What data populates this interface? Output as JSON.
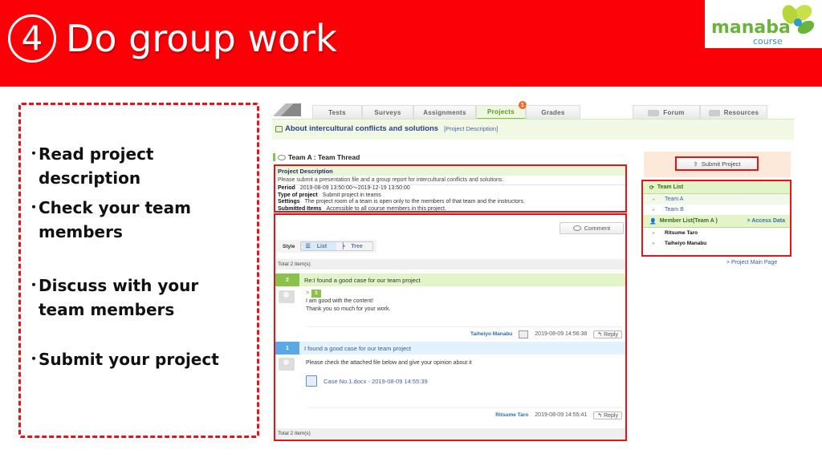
{
  "slide": {
    "step_number": "4",
    "title": "Do group work",
    "logo": {
      "brand": "manaba",
      "sub": "course"
    },
    "steps": [
      {
        "bullet": "・",
        "text": "Read project description"
      },
      {
        "bullet": "・",
        "text": "Check your team members"
      },
      {
        "bullet": "・",
        "text": "Discuss with your team members"
      },
      {
        "bullet": "・",
        "text": "Submit your project"
      }
    ]
  },
  "app": {
    "tabs": [
      {
        "label": "Tests"
      },
      {
        "label": "Surveys"
      },
      {
        "label": "Assignments"
      },
      {
        "label": "Projects",
        "badge": "1",
        "active": true
      },
      {
        "label": "Grades"
      }
    ],
    "right_tabs": [
      {
        "label": "Forum",
        "icon": "speech-bubble-icon"
      },
      {
        "label": "Resources",
        "icon": "book-icon"
      }
    ],
    "course_title": "About intercultural conflicts and solutions",
    "course_sub": "[Project Description]",
    "thread_title": "Team A : Team Thread",
    "description": {
      "heading": "Project Description",
      "text": "Please submit a presentation file and a group report for intercultural conflicts and solutions.",
      "meta": [
        {
          "label": "Period",
          "value": "2019-08-09 13:50:00～2019-12-19 13:50:00"
        },
        {
          "label": "Type of project",
          "value": "Submit project in teams"
        },
        {
          "label": "Settings",
          "value": "The project room of a team is open only to the members of that team and the instructors."
        },
        {
          "label": "Submitted Items",
          "value": "Accessible to all course members in this project."
        }
      ]
    },
    "comment_label": "Comment",
    "style_label": "Style",
    "style_options": {
      "list": "List",
      "tree": "Tree"
    },
    "total_label": "Total 2 item(s)",
    "posts": [
      {
        "number": "2",
        "title": "Re:I found a good case for our team project",
        "reply_to": "1",
        "lines": [
          "I am good with the content!",
          "Thank you so much for your work."
        ],
        "author": "Taiheiyo Manabu",
        "timestamp": "2019-08-09 14:56:38",
        "reply_label": "Reply"
      },
      {
        "number": "1",
        "title": "I found a good case for our team project",
        "lines": [
          "Please check the attached file below and give your opinion about it"
        ],
        "attachment": "Case No.1.docx - 2019-08-09 14:55:39",
        "author": "Ritsume Taro",
        "timestamp": "2019-08-09 14:55:41",
        "reply_label": "Reply"
      }
    ],
    "sidebar": {
      "submit_label": "Submit Project",
      "team_list_label": "Team List",
      "teams": [
        "Team A",
        "Team B"
      ],
      "member_list_label": "Member List(Team A )",
      "access_data_label": "> Access Data",
      "members": [
        "Ritsume Taro",
        "Taiheiyo Manabu"
      ],
      "main_page_link": "> Project Main Page"
    }
  },
  "colors": {
    "banner": "#fb0007",
    "highlight_border": "#e8121a",
    "accent_green": "#8bc34a",
    "accent_blue": "#5ba9e4"
  }
}
